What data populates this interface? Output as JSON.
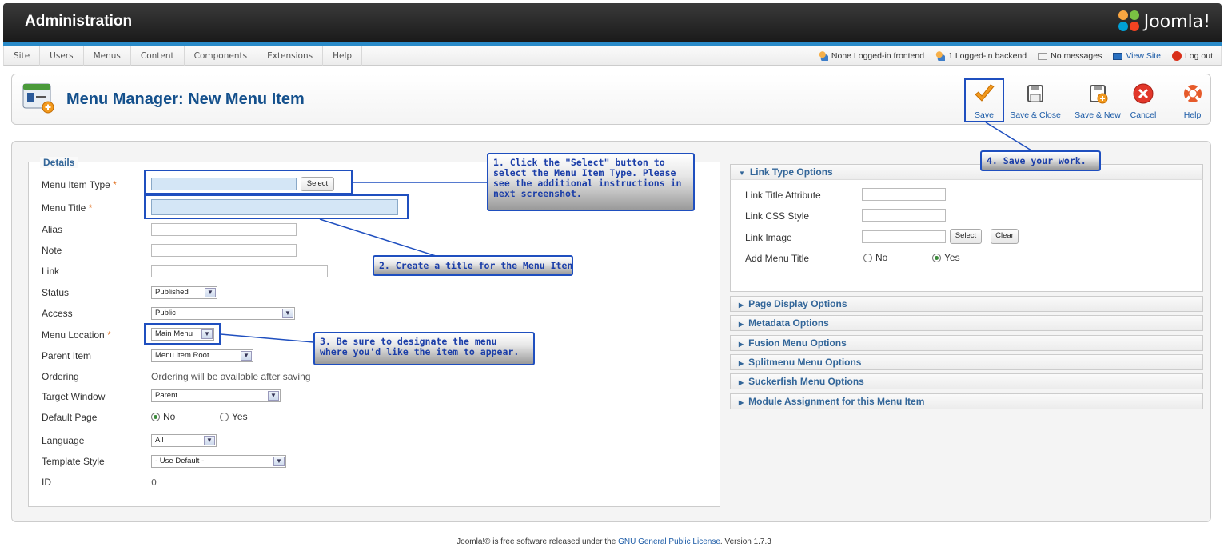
{
  "header": {
    "title": "Administration",
    "logo_text": "Joomla!"
  },
  "menu": {
    "items": [
      "Site",
      "Users",
      "Menus",
      "Content",
      "Components",
      "Extensions",
      "Help"
    ]
  },
  "status": {
    "frontend": "None Logged-in frontend",
    "backend": "1 Logged-in backend",
    "messages": "No messages",
    "view_site": "View Site",
    "logout": "Log out"
  },
  "toolbar": {
    "page_title": "Menu Manager: New Menu Item",
    "save": "Save",
    "save_close": "Save & Close",
    "save_new": "Save & New",
    "cancel": "Cancel",
    "help": "Help"
  },
  "details": {
    "legend": "Details",
    "menu_item_type": "Menu Item Type",
    "select_button": "Select",
    "menu_title": "Menu Title",
    "alias": "Alias",
    "note": "Note",
    "link": "Link",
    "status": "Status",
    "status_value": "Published",
    "access": "Access",
    "access_value": "Public",
    "menu_location": "Menu Location",
    "menu_location_value": "Main Menu",
    "parent_item": "Parent Item",
    "parent_item_value": "Menu Item Root",
    "ordering": "Ordering",
    "ordering_value": "Ordering will be available after saving",
    "target_window": "Target Window",
    "target_window_value": "Parent",
    "default_page": "Default Page",
    "no": "No",
    "yes": "Yes",
    "language": "Language",
    "language_value": "All",
    "template_style": "Template Style",
    "template_style_value": "- Use Default -",
    "id": "ID",
    "id_value": "0",
    "required_mark": "*"
  },
  "link_options": {
    "title": "Link Type Options",
    "link_title_attribute": "Link Title Attribute",
    "link_css_style": "Link CSS Style",
    "link_image": "Link Image",
    "select": "Select",
    "clear": "Clear",
    "add_menu_title": "Add Menu Title",
    "no": "No",
    "yes": "Yes"
  },
  "panels": [
    "Page Display Options",
    "Metadata Options",
    "Fusion Menu Options",
    "Splitmenu Menu Options",
    "Suckerfish Menu Options",
    "Module Assignment for this Menu Item"
  ],
  "callouts": {
    "c1_line1": "1. Click the \"Select\" button to",
    "c1_line2": "select the Menu Item Type. Please",
    "c1_line3": "see the additional instructions in",
    "c1_line4": "next screenshot.",
    "c2": "2. Create a title for the Menu Iten",
    "c3_line1": "3. Be sure to designate the menu",
    "c3_line2": "where you'd like the item to appear.",
    "c4": "4. Save your work."
  },
  "footer": {
    "prefix": "Joomla!® is free software released under the ",
    "license": "GNU General Public License",
    "version": ".   Version 1.7.3"
  }
}
